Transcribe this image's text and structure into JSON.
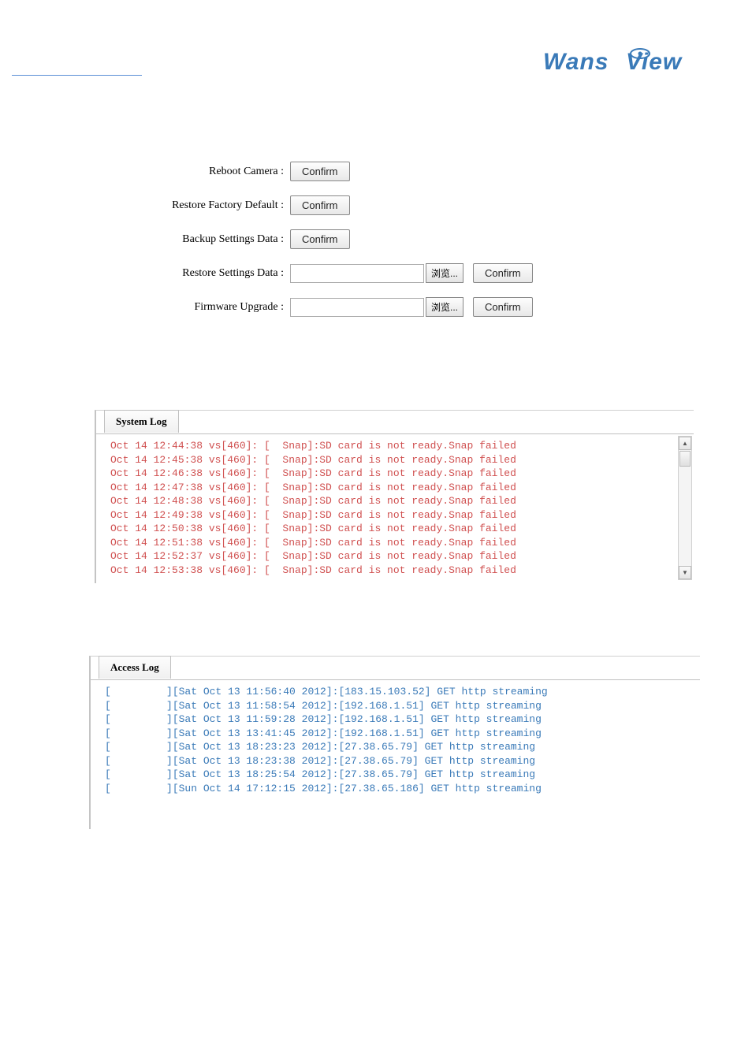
{
  "logo_text": "WansView",
  "settings": {
    "reboot_label": "Reboot Camera :",
    "restore_factory_label": "Restore Factory Default :",
    "backup_label": "Backup Settings Data :",
    "restore_settings_label": "Restore Settings Data :",
    "firmware_label": "Firmware Upgrade :",
    "confirm_label": "Confirm",
    "browse_label": "浏览..."
  },
  "system_log": {
    "tab_label": "System Log",
    "lines": [
      "Oct 14 12:44:38 vs[460]: [  Snap]:SD card is not ready.Snap failed",
      "Oct 14 12:45:38 vs[460]: [  Snap]:SD card is not ready.Snap failed",
      "Oct 14 12:46:38 vs[460]: [  Snap]:SD card is not ready.Snap failed",
      "Oct 14 12:47:38 vs[460]: [  Snap]:SD card is not ready.Snap failed",
      "Oct 14 12:48:38 vs[460]: [  Snap]:SD card is not ready.Snap failed",
      "Oct 14 12:49:38 vs[460]: [  Snap]:SD card is not ready.Snap failed",
      "Oct 14 12:50:38 vs[460]: [  Snap]:SD card is not ready.Snap failed",
      "Oct 14 12:51:38 vs[460]: [  Snap]:SD card is not ready.Snap failed",
      "Oct 14 12:52:37 vs[460]: [  Snap]:SD card is not ready.Snap failed",
      "Oct 14 12:53:38 vs[460]: [  Snap]:SD card is not ready.Snap failed"
    ]
  },
  "access_log": {
    "tab_label": "Access Log",
    "lines": [
      "[         ][Sat Oct 13 11:56:40 2012]:[183.15.103.52] GET http streaming",
      "[         ][Sat Oct 13 11:58:54 2012]:[192.168.1.51] GET http streaming",
      "[         ][Sat Oct 13 11:59:28 2012]:[192.168.1.51] GET http streaming",
      "[         ][Sat Oct 13 13:41:45 2012]:[192.168.1.51] GET http streaming",
      "[         ][Sat Oct 13 18:23:23 2012]:[27.38.65.79] GET http streaming",
      "[         ][Sat Oct 13 18:23:38 2012]:[27.38.65.79] GET http streaming",
      "[         ][Sat Oct 13 18:25:54 2012]:[27.38.65.79] GET http streaming",
      "[         ][Sun Oct 14 17:12:15 2012]:[27.38.65.186] GET http streaming"
    ]
  }
}
